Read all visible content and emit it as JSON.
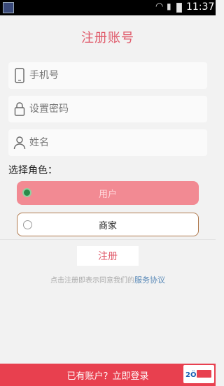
{
  "status_bar": {
    "time": "11:37"
  },
  "header": {
    "title": "注册账号"
  },
  "form": {
    "phone": {
      "placeholder": "手机号",
      "value": ""
    },
    "password": {
      "placeholder": "设置密码",
      "value": ""
    },
    "name": {
      "placeholder": "姓名",
      "value": ""
    }
  },
  "role": {
    "label": "选择角色：",
    "options": [
      {
        "label": "用户",
        "selected": true
      },
      {
        "label": "商家",
        "selected": false
      }
    ]
  },
  "actions": {
    "register_label": "注册"
  },
  "agreement": {
    "text": "点击注册即表示同意我们的",
    "link": "服务协议"
  },
  "footer": {
    "login_text": "已有账户？立即登录"
  },
  "colors": {
    "accent": "#e05a6a",
    "footer_bg": "#e8404f",
    "selected_role_bg": "#f28a93"
  }
}
